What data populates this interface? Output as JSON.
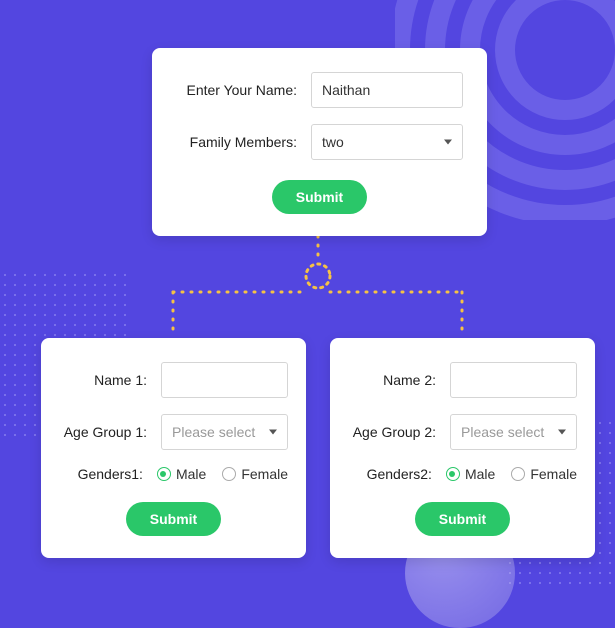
{
  "top_form": {
    "name_label": "Enter Your Name:",
    "name_value": "Naithan",
    "family_label": "Family Members:",
    "family_value": "two",
    "submit_label": "Submit"
  },
  "form1": {
    "name_label": "Name 1:",
    "age_label": "Age Group 1:",
    "age_placeholder": "Please select",
    "gender_label": "Genders1:",
    "male_label": "Male",
    "female_label": "Female",
    "submit_label": "Submit"
  },
  "form2": {
    "name_label": "Name 2:",
    "age_label": "Age Group 2:",
    "age_placeholder": "Please select",
    "gender_label": "Genders2:",
    "male_label": "Male",
    "female_label": "Female",
    "submit_label": "Submit"
  }
}
